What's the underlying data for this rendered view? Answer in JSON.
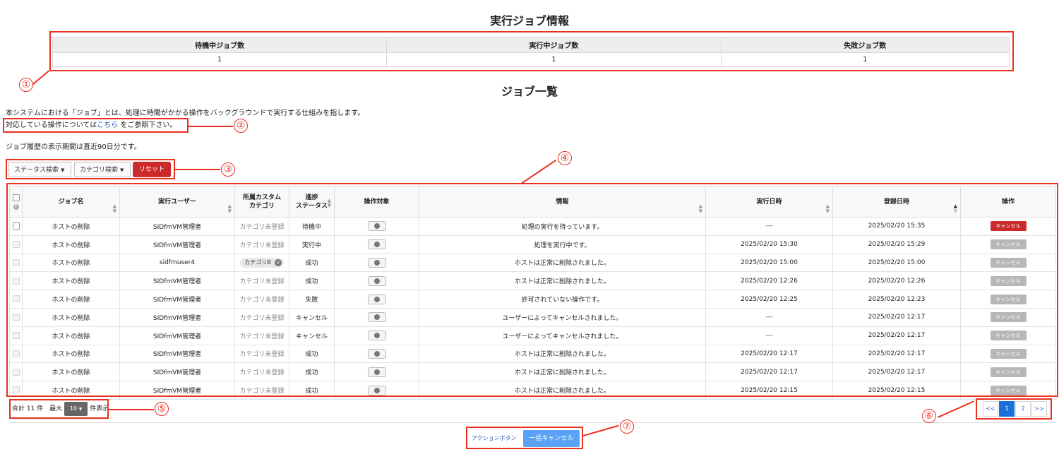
{
  "summary": {
    "title": "実行ジョブ情報",
    "headers": [
      "待機中ジョブ数",
      "実行中ジョブ数",
      "失敗ジョブ数"
    ],
    "values": [
      "1",
      "1",
      "1"
    ]
  },
  "list": {
    "title": "ジョブ一覧",
    "desc1": "本システムにおける「ジョブ」とは、処理に時間がかかる操作をバックグラウンドで実行する仕組みを指します。",
    "desc2_pre": "対応している操作については",
    "desc2_link": "こちら",
    "desc2_post": "をご参照下さい。",
    "desc3": "ジョブ履歴の表示期間は直近90日分です。"
  },
  "filters": {
    "status_label": "ステータス検索",
    "category_label": "カテゴリ検索",
    "reset_label": "リセット"
  },
  "table": {
    "headers": {
      "job_name": "ジョブ名",
      "user": "実行ユーザー",
      "category_l1": "所属カスタム",
      "category_l2": "カテゴリ",
      "status_l1": "進捗",
      "status_l2": "ステータス",
      "target": "操作対象",
      "info": "情報",
      "exec_date": "実行日時",
      "reg_date": "登録日時",
      "action": "操作"
    },
    "rows": [
      {
        "name": "ホストの削除",
        "user": "SIDfmVM管理者",
        "category": "カテゴリ未登録",
        "status": "待機中",
        "info": "処理の実行を待っています。",
        "exec": "---",
        "reg": "2025/02/20 15:35",
        "cancel": "キャンセル",
        "active": true
      },
      {
        "name": "ホストの削除",
        "user": "SIDfmVM管理者",
        "category": "カテゴリ未登録",
        "status": "実行中",
        "info": "処理を実行中です。",
        "exec": "2025/02/20 15:30",
        "reg": "2025/02/20 15:29",
        "cancel": "キャンセル",
        "active": false
      },
      {
        "name": "ホストの削除",
        "user": "sidfmuser4",
        "category": "カテゴリB",
        "status": "成功",
        "info": "ホストは正常に削除されました。",
        "exec": "2025/02/20 15:00",
        "reg": "2025/02/20 15:00",
        "cancel": "キャンセル",
        "active": false,
        "badge": true
      },
      {
        "name": "ホストの削除",
        "user": "SIDfmVM管理者",
        "category": "カテゴリ未登録",
        "status": "成功",
        "info": "ホストは正常に削除されました。",
        "exec": "2025/02/20 12:26",
        "reg": "2025/02/20 12:26",
        "cancel": "キャンセル",
        "active": false
      },
      {
        "name": "ホストの削除",
        "user": "SIDfmVM管理者",
        "category": "カテゴリ未登録",
        "status": "失敗",
        "info": "許可されていない操作です。",
        "exec": "2025/02/20 12:25",
        "reg": "2025/02/20 12:23",
        "cancel": "キャンセル",
        "active": false
      },
      {
        "name": "ホストの削除",
        "user": "SIDfmVM管理者",
        "category": "カテゴリ未登録",
        "status": "キャンセル",
        "info": "ユーザーによってキャンセルされました。",
        "exec": "---",
        "reg": "2025/02/20 12:17",
        "cancel": "キャンセル",
        "active": false
      },
      {
        "name": "ホストの削除",
        "user": "SIDfmVM管理者",
        "category": "カテゴリ未登録",
        "status": "キャンセル",
        "info": "ユーザーによってキャンセルされました。",
        "exec": "---",
        "reg": "2025/02/20 12:17",
        "cancel": "キャンセル",
        "active": false
      },
      {
        "name": "ホストの削除",
        "user": "SIDfmVM管理者",
        "category": "カテゴリ未登録",
        "status": "成功",
        "info": "ホストは正常に削除されました。",
        "exec": "2025/02/20 12:17",
        "reg": "2025/02/20 12:17",
        "cancel": "キャンセル",
        "active": false
      },
      {
        "name": "ホストの削除",
        "user": "SIDfmVM管理者",
        "category": "カテゴリ未登録",
        "status": "成功",
        "info": "ホストは正常に削除されました。",
        "exec": "2025/02/20 12:17",
        "reg": "2025/02/20 12:17",
        "cancel": "キャンセル",
        "active": false
      },
      {
        "name": "ホストの削除",
        "user": "SIDfmVM管理者",
        "category": "カテゴリ未登録",
        "status": "成功",
        "info": "ホストは正常に削除されました。",
        "exec": "2025/02/20 12:15",
        "reg": "2025/02/20 12:15",
        "cancel": "キャンセル",
        "active": false
      }
    ]
  },
  "footer": {
    "total_label": "合計 11 件",
    "max_label": "最大",
    "per_page_value": "10",
    "per_page_suffix": "件表示",
    "pages": [
      "<<",
      "1",
      "2",
      ">>"
    ],
    "active_page": "1",
    "action_label": "アクションボタン",
    "bulk_cancel_label": "一括キャンセル"
  },
  "annotations": [
    "①",
    "②",
    "③",
    "④",
    "⑤",
    "⑥",
    "⑦"
  ],
  "colors": {
    "annotation": "#e8311f",
    "danger": "#cc2b2b",
    "primary": "#1a6fd8",
    "bulk_button": "#5aa2f5"
  }
}
